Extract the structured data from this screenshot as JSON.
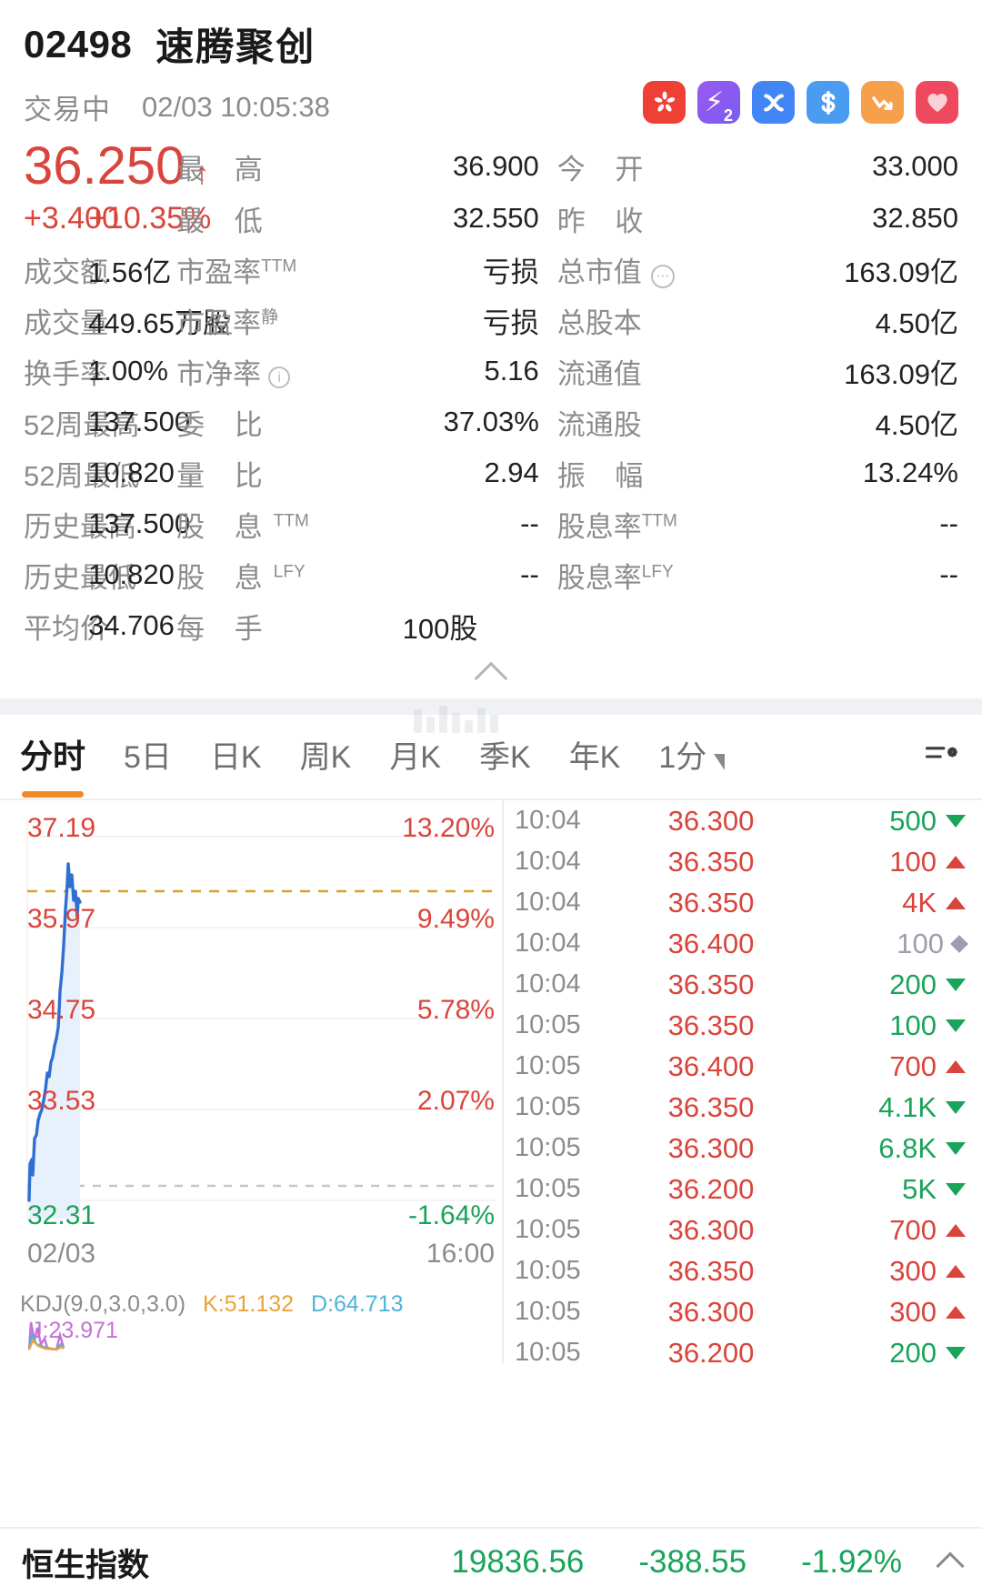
{
  "header": {
    "code": "02498",
    "name": "速腾聚创",
    "status": "交易中",
    "timestamp": "02/03 10:05:38",
    "badges": [
      {
        "name": "hk-flag-icon",
        "glyph": "✾",
        "color": "#ef4036"
      },
      {
        "name": "lightning-2-icon",
        "glyph": "⚡",
        "sub": "2",
        "color": "#8d5cf0"
      },
      {
        "name": "shuffle-icon",
        "glyph": "✕",
        "color": "#4285f4"
      },
      {
        "name": "dollar-icon",
        "glyph": "$",
        "color": "#4a9cf0"
      },
      {
        "name": "downtrend-icon",
        "glyph": "↘",
        "color": "#f7a04b"
      },
      {
        "name": "heart-icon",
        "glyph": "♥",
        "color": "#ef4960"
      }
    ]
  },
  "quote": {
    "last_price": "36.250",
    "change": "+3.400",
    "change_pct": "+10.35%",
    "arrow": "↑",
    "color_up": "#d9453c",
    "color_down": "#1aa35a"
  },
  "stats": {
    "rows": [
      [
        {
          "label": "最 高",
          "value": "36.900"
        },
        {
          "label": "今 开",
          "value": "33.000"
        }
      ],
      [
        {
          "label": "最 低",
          "value": "32.550"
        },
        {
          "label": "昨 收",
          "value": "32.850"
        }
      ],
      [
        {
          "label": "成交额",
          "value": "1.56亿"
        },
        {
          "label": "市盈率",
          "sup": "TTM",
          "value": "亏损"
        },
        {
          "label": "总市值",
          "icon": "dots",
          "value": "163.09亿"
        }
      ],
      [
        {
          "label": "成交量",
          "value": "449.65万股"
        },
        {
          "label": "市盈率",
          "sup": "静",
          "value": "亏损"
        },
        {
          "label": "总股本",
          "value": "4.50亿"
        }
      ],
      [
        {
          "label": "换手率",
          "value": "1.00%"
        },
        {
          "label": "市净率",
          "icon": "info",
          "value": "5.16"
        },
        {
          "label": "流通值",
          "value": "163.09亿"
        }
      ],
      [
        {
          "label": "52周最高",
          "value": "137.500"
        },
        {
          "label": "委 比",
          "value": "37.03%"
        },
        {
          "label": "流通股",
          "value": "4.50亿"
        }
      ],
      [
        {
          "label": "52周最低",
          "value": "10.820"
        },
        {
          "label": "量 比",
          "value": "2.94"
        },
        {
          "label": "振 幅",
          "value": "13.24%"
        }
      ],
      [
        {
          "label": "历史最高",
          "value": "137.500"
        },
        {
          "label": "股 息",
          "sup": "TTM",
          "value": "--"
        },
        {
          "label": "股息率",
          "sup": "TTM",
          "value": "--"
        }
      ],
      [
        {
          "label": "历史最低",
          "value": "10.820"
        },
        {
          "label": "股 息",
          "sup": "LFY",
          "value": "--"
        },
        {
          "label": "股息率",
          "sup": "LFY",
          "value": "--"
        }
      ],
      [
        {
          "label": "平均价",
          "value": "34.706"
        },
        {
          "label": "每 手",
          "value": "100股"
        }
      ]
    ]
  },
  "tabs": {
    "items": [
      "分时",
      "5日",
      "日K",
      "周K",
      "月K",
      "季K",
      "年K"
    ],
    "active": "分时",
    "interval": "1分",
    "settings_icon": "chart-settings-icon"
  },
  "chart_data": {
    "type": "line",
    "title": "分时",
    "date": "02/03",
    "end_time": "16:00",
    "prev_close": 32.85,
    "y_axis_left": [
      "37.19",
      "35.97",
      "34.75",
      "33.53",
      "32.31"
    ],
    "y_axis_right": [
      "13.20%",
      "9.49%",
      "5.78%",
      "2.07%",
      "-1.64%"
    ],
    "ylim": [
      32.31,
      37.19
    ],
    "xlabels": [
      "02/03",
      "16:00"
    ],
    "avg_line": 36.25,
    "series": [
      {
        "name": "price",
        "color": "#2f6fd0",
        "values": [
          32.4,
          32.7,
          33.0,
          33.1,
          33.05,
          33.3,
          33.55,
          33.45,
          33.7,
          33.9,
          34.0,
          33.85,
          34.1,
          34.3,
          34.2,
          34.45,
          34.6,
          34.5,
          34.75,
          34.95,
          34.85,
          35.1,
          35.3,
          35.25,
          35.5,
          35.8,
          36.1,
          36.4,
          36.7,
          36.9,
          36.6,
          36.75,
          36.45,
          36.2,
          36.3,
          36.25
        ]
      }
    ],
    "indicator": {
      "name": "KDJ(9.0,3.0,3.0)",
      "K": "K:51.132",
      "D": "D:64.713",
      "J": "J:23.971",
      "k_color": "#e8a33d",
      "d_color": "#4fb3d9",
      "j_color": "#c471d9"
    }
  },
  "tape": {
    "rows": [
      {
        "time": "10:04",
        "price": "36.300",
        "vol": "500",
        "dir": "down"
      },
      {
        "time": "10:04",
        "price": "36.350",
        "vol": "100",
        "dir": "up"
      },
      {
        "time": "10:04",
        "price": "36.350",
        "vol": "4K",
        "dir": "up"
      },
      {
        "time": "10:04",
        "price": "36.400",
        "vol": "100",
        "dir": "flat"
      },
      {
        "time": "10:04",
        "price": "36.350",
        "vol": "200",
        "dir": "down"
      },
      {
        "time": "10:05",
        "price": "36.350",
        "vol": "100",
        "dir": "down"
      },
      {
        "time": "10:05",
        "price": "36.400",
        "vol": "700",
        "dir": "up"
      },
      {
        "time": "10:05",
        "price": "36.350",
        "vol": "4.1K",
        "dir": "down"
      },
      {
        "time": "10:05",
        "price": "36.300",
        "vol": "6.8K",
        "dir": "down"
      },
      {
        "time": "10:05",
        "price": "36.200",
        "vol": "5K",
        "dir": "down"
      },
      {
        "time": "10:05",
        "price": "36.300",
        "vol": "700",
        "dir": "up"
      },
      {
        "time": "10:05",
        "price": "36.350",
        "vol": "300",
        "dir": "up"
      },
      {
        "time": "10:05",
        "price": "36.300",
        "vol": "300",
        "dir": "up"
      },
      {
        "time": "10:05",
        "price": "36.200",
        "vol": "200",
        "dir": "down"
      }
    ]
  },
  "index_bar": {
    "name": "恒生指数",
    "value": "19836.56",
    "change": "-388.55",
    "change_pct": "-1.92%"
  }
}
